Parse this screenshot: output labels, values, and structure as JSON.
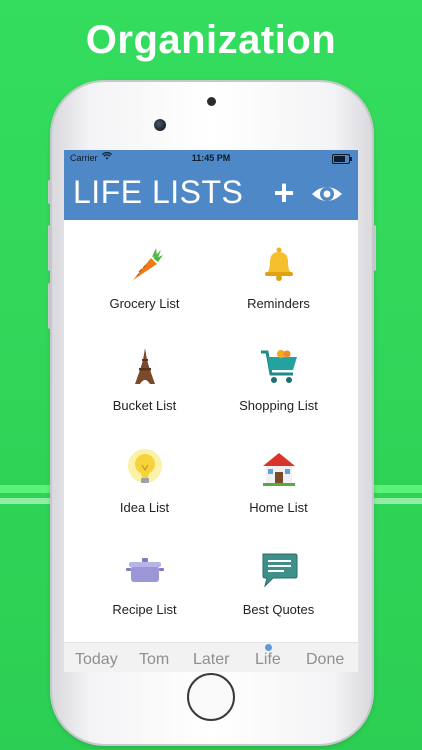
{
  "headline": "Organization",
  "status_bar": {
    "carrier": "Carrier",
    "time": "11:45 PM"
  },
  "app": {
    "title": "LIFE LISTS",
    "add_label": "+",
    "colors": {
      "header": "#4f88c6",
      "background": "#2fd65a"
    }
  },
  "lists": [
    {
      "label": "Grocery List",
      "icon": "carrot-icon"
    },
    {
      "label": "Reminders",
      "icon": "bell-icon"
    },
    {
      "label": "Bucket List",
      "icon": "eiffel-tower-icon"
    },
    {
      "label": "Shopping List",
      "icon": "shopping-cart-icon"
    },
    {
      "label": "Idea List",
      "icon": "light-bulb-icon"
    },
    {
      "label": "Home List",
      "icon": "house-icon"
    },
    {
      "label": "Recipe List",
      "icon": "cooking-pot-icon"
    },
    {
      "label": "Best Quotes",
      "icon": "speech-bubble-icon"
    }
  ],
  "tabs": [
    "Today",
    "Tom",
    "Later",
    "Life",
    "Done"
  ],
  "active_tab": "Life"
}
